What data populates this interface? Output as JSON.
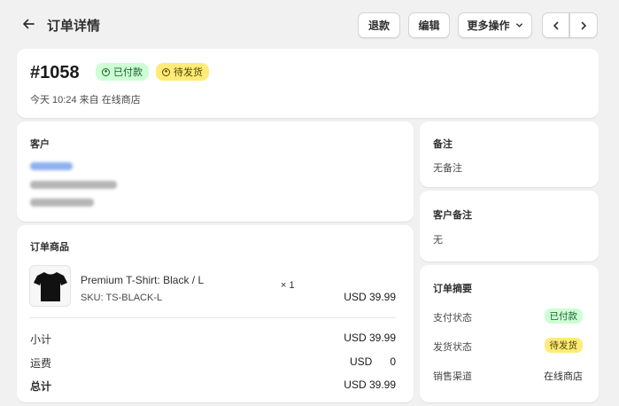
{
  "header": {
    "title": "订单详情",
    "buttons": {
      "refund": "退款",
      "edit": "编辑",
      "more": "更多操作"
    }
  },
  "order": {
    "number": "#1058",
    "payment_badge": "已付款",
    "fulfillment_badge": "待发货",
    "meta": "今天 10:24 来自 在线商店"
  },
  "customer": {
    "title": "客户"
  },
  "items": {
    "title": "订单商品",
    "product": {
      "name": "Premium T-Shirt: Black / L",
      "sku": "SKU: TS-BLACK-L",
      "qty": "× 1",
      "price": "USD 39.99"
    },
    "summary": {
      "subtotal_label": "小计",
      "subtotal_value": "USD 39.99",
      "shipping_label": "运费",
      "shipping_value": "USD      0",
      "total_label": "总计",
      "total_value": "USD 39.99"
    }
  },
  "notes": {
    "title": "备注",
    "value": "无备注"
  },
  "customer_notes": {
    "title": "客户备注",
    "value": "无"
  },
  "order_summary": {
    "title": "订单摘要",
    "payment_label": "支付状态",
    "payment_value": "已付款",
    "shipping_label": "发货状态",
    "shipping_value": "待发货",
    "channel_label": "销售渠道",
    "channel_value": "在线商店"
  },
  "colors": {
    "paid_bg": "#cdfed4",
    "unfulfilled_bg": "#ffeb78",
    "page_bg": "#f1f1f1"
  },
  "icons": [
    "back-arrow-icon",
    "chevron-down-icon",
    "chevron-left-icon",
    "chevron-right-icon",
    "status-dot-icon",
    "tshirt-icon"
  ]
}
